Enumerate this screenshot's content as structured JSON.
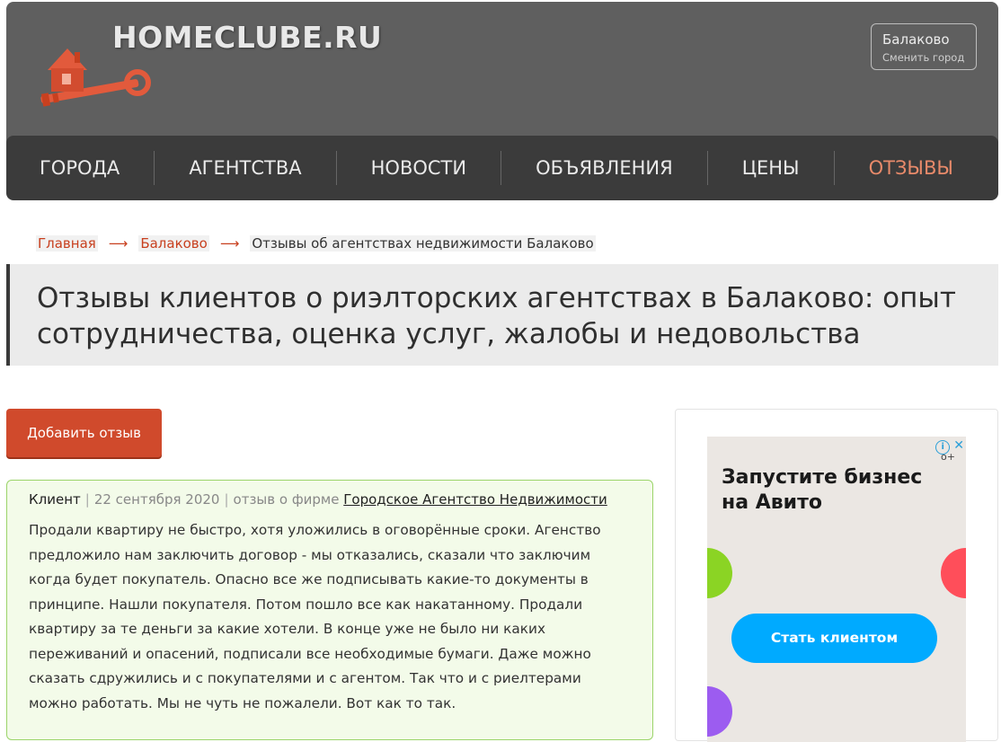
{
  "header": {
    "site_name": "HOMECLUBE.RU",
    "city": "Балаково",
    "change_city": "Сменить город"
  },
  "nav": {
    "items": [
      {
        "label": "ГОРОДА"
      },
      {
        "label": "АГЕНТСТВА"
      },
      {
        "label": "НОВОСТИ"
      },
      {
        "label": "ОБЪЯВЛЕНИЯ"
      },
      {
        "label": "ЦЕНЫ"
      },
      {
        "label": "ОТЗЫВЫ"
      }
    ],
    "active_color": "#e88a6a"
  },
  "breadcrumb": {
    "home": "Главная",
    "city": "Балаково",
    "current": "Отзывы об агентствах недвижимости Балаково",
    "arrow": "⟶"
  },
  "page_title": "Отзывы клиентов о риэлторских агентствах в Балаково: опыт сотрудничества, оценка услуг, жалобы и недовольства",
  "add_review_label": "Добавить отзыв",
  "review": {
    "author": "Клиент",
    "date": "22 сентября 2020",
    "about_label": "отзыв о фирме",
    "firm": "Городское Агентство Недвижимости",
    "text": "Продали квартиру не быстро, хотя уложились в оговорённые сроки. Агенство предложило нам заключить договор - мы отказались, сказали что заключим когда будет покупатель. Опасно все же подписывать какие-то документы в принципе. Нашли покупателя. Потом пошло все как накатанному. Продали квартиру за те деньги за какие хотели. В конце уже не было ни каких переживаний и опасений, подписали все необходимые бумаги. Даже можно сказать сдружились и с покупателями и с агентом. Так что и с риелтерами можно работать. Мы не чуть не пожалели. Вот как то так."
  },
  "ad": {
    "title": "Запустите бизнес на Авито",
    "cta": "Стать клиентом",
    "info_icon": "info-icon",
    "close_icon": "close-icon"
  },
  "colors": {
    "header_bg": "#5f5f5f",
    "nav_bg": "#3b3b3b",
    "accent": "#d04a2c",
    "review_bg": "#f3fbe9",
    "review_border": "#9bd46a",
    "ad_cta": "#00aaff"
  }
}
